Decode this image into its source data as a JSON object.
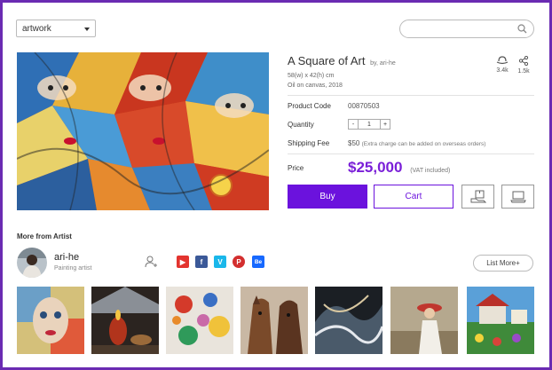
{
  "filter": {
    "selected": "artwork"
  },
  "search": {
    "placeholder": ""
  },
  "artwork": {
    "title": "A Square of Art",
    "by_line": "by, ari-he",
    "dimensions": "58(w) x 42(h) cm",
    "medium": "Oil on canvas, 2018",
    "stats": {
      "likes": "3.4k",
      "shares": "1.5k"
    },
    "product_code_label": "Product Code",
    "product_code": "00870503",
    "quantity_label": "Quantity",
    "quantity": {
      "minus": "-",
      "value": "1",
      "plus": "+"
    },
    "shipping_label": "Shipping Fee",
    "shipping_value": "$50",
    "shipping_note": "(Extra charge can be added on overseas orders)",
    "price_label": "Price",
    "price": "$25,000",
    "vat": "(VAT included)",
    "buy_label": "Buy",
    "cart_label": "Cart"
  },
  "artist": {
    "section_title": "More from Artist",
    "name": "ari-he",
    "role": "Painting artist",
    "social": {
      "youtube": "▶",
      "facebook": "f",
      "vimeo": "V",
      "pinterest": "P",
      "behance": "Be"
    },
    "list_more": "List More+"
  },
  "colors": {
    "accent": "#6b12dd",
    "frame": "#6a2bb2"
  },
  "icons": [
    "caret-down-icon",
    "search-icon",
    "like-hat-icon",
    "share-icon",
    "package-icon",
    "laptop-icon",
    "follow-user-icon"
  ]
}
